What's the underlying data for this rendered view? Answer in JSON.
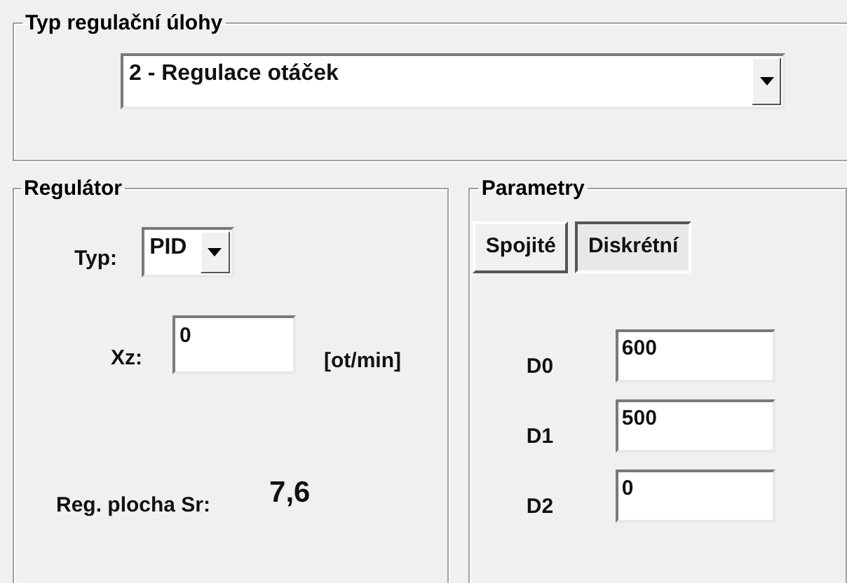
{
  "task_group": {
    "title": "Typ regulační úlohy",
    "combo": {
      "value": "2 - Regulace otáček"
    }
  },
  "controller": {
    "title": "Regulátor",
    "type_label": "Typ:",
    "type_combo": {
      "value": "PID"
    },
    "xz_label": "Xz:",
    "xz_field": {
      "value": "0"
    },
    "xz_unit": "[ot/min]",
    "area_label": "Reg. plocha Sr:",
    "area_value": "7,6"
  },
  "parameters": {
    "title": "Parametry",
    "modes": [
      {
        "label": "Spojité",
        "selected": false
      },
      {
        "label": "Diskrétní",
        "selected": true
      }
    ],
    "fields": [
      {
        "label": "D0",
        "value": "600"
      },
      {
        "label": "D1",
        "value": "500"
      },
      {
        "label": "D2",
        "value": "0"
      }
    ]
  }
}
